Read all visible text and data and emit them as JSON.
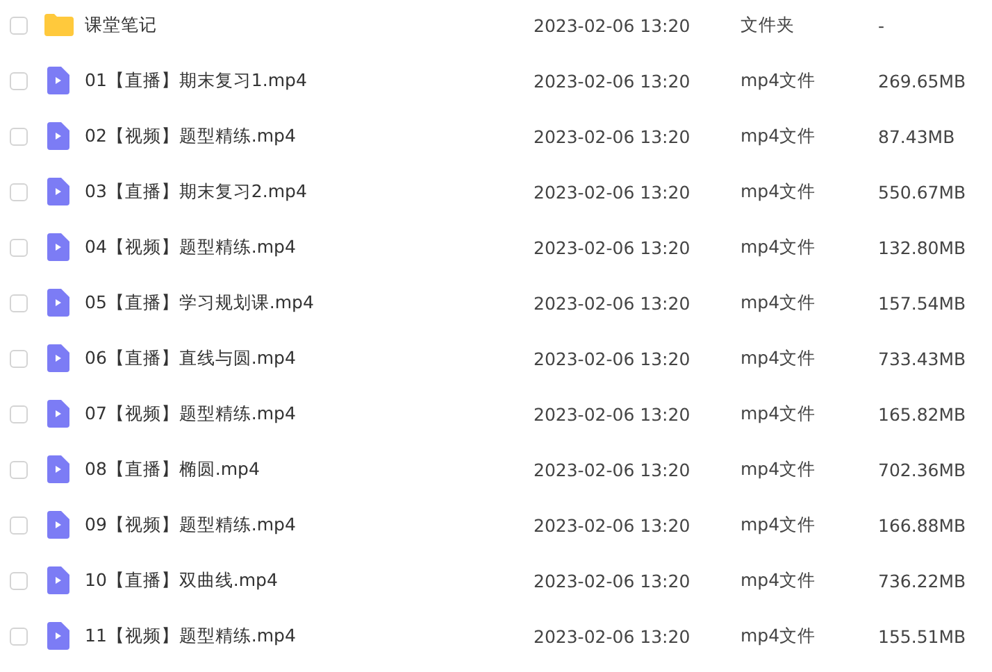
{
  "files": [
    {
      "kind": "folder",
      "name": "课堂笔记",
      "modified": "2023-02-06 13:20",
      "type": "文件夹",
      "size": "-",
      "checked": false
    },
    {
      "kind": "video",
      "name": "01【直播】期末复习1.mp4",
      "modified": "2023-02-06 13:20",
      "type": "mp4文件",
      "size": "269.65MB",
      "checked": false
    },
    {
      "kind": "video",
      "name": "02【视频】题型精练.mp4",
      "modified": "2023-02-06 13:20",
      "type": "mp4文件",
      "size": "87.43MB",
      "checked": false
    },
    {
      "kind": "video",
      "name": "03【直播】期末复习2.mp4",
      "modified": "2023-02-06 13:20",
      "type": "mp4文件",
      "size": "550.67MB",
      "checked": false
    },
    {
      "kind": "video",
      "name": "04【视频】题型精练.mp4",
      "modified": "2023-02-06 13:20",
      "type": "mp4文件",
      "size": "132.80MB",
      "checked": false
    },
    {
      "kind": "video",
      "name": "05【直播】学习规划课.mp4",
      "modified": "2023-02-06 13:20",
      "type": "mp4文件",
      "size": "157.54MB",
      "checked": false
    },
    {
      "kind": "video",
      "name": "06【直播】直线与圆.mp4",
      "modified": "2023-02-06 13:20",
      "type": "mp4文件",
      "size": "733.43MB",
      "checked": false
    },
    {
      "kind": "video",
      "name": "07【视频】题型精练.mp4",
      "modified": "2023-02-06 13:20",
      "type": "mp4文件",
      "size": "165.82MB",
      "checked": false
    },
    {
      "kind": "video",
      "name": "08【直播】椭圆.mp4",
      "modified": "2023-02-06 13:20",
      "type": "mp4文件",
      "size": "702.36MB",
      "checked": false
    },
    {
      "kind": "video",
      "name": "09【视频】题型精练.mp4",
      "modified": "2023-02-06 13:20",
      "type": "mp4文件",
      "size": "166.88MB",
      "checked": false
    },
    {
      "kind": "video",
      "name": "10【直播】双曲线.mp4",
      "modified": "2023-02-06 13:20",
      "type": "mp4文件",
      "size": "736.22MB",
      "checked": false
    },
    {
      "kind": "video",
      "name": "11【视频】题型精练.mp4",
      "modified": "2023-02-06 13:20",
      "type": "mp4文件",
      "size": "155.51MB",
      "checked": false
    }
  ]
}
